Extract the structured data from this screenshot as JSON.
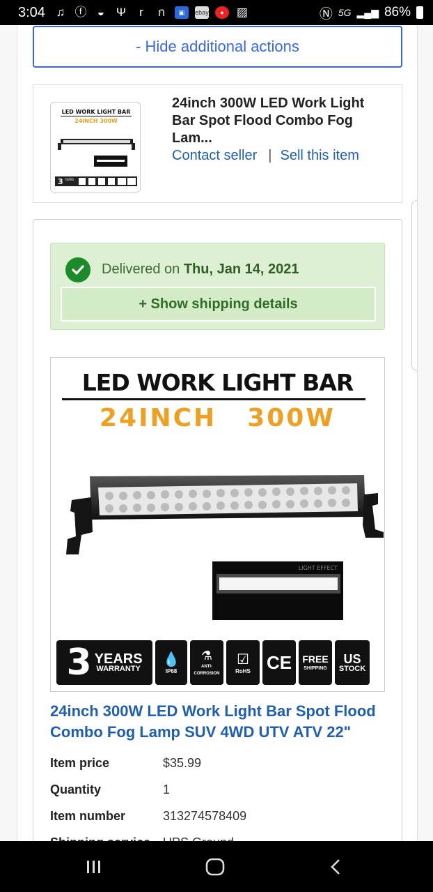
{
  "status_bar": {
    "time": "3:04",
    "signal": "5G",
    "battery": "86%"
  },
  "actions": {
    "hide_label": "- Hide additional actions"
  },
  "item_summary": {
    "title": "24inch 300W LED Work Light Bar Spot Flood Combo Fog Lam...",
    "contact_seller": "Contact seller",
    "separator": "|",
    "sell_item": "Sell this item"
  },
  "delivery": {
    "prefix": "Delivered on ",
    "date": "Thu, Jan 14, 2021",
    "show_shipping": "+ Show shipping details"
  },
  "product_image": {
    "heading": "LED WORK LIGHT BAR",
    "size": "24INCH",
    "power": "300W",
    "light_effect": "LIGHT EFFECT",
    "badges": {
      "warranty_num": "3",
      "warranty_years": "YEARS",
      "warranty_word": "WARRANTY",
      "ip": "IP68",
      "corrosion": "ANTI-CORROSION",
      "rohs": "RoHS",
      "ce": "CE",
      "free": "FREE",
      "shipping": "SHIPPING",
      "us": "US",
      "stock": "STOCK"
    }
  },
  "product": {
    "title": "24inch 300W LED Work Light Bar Spot Flood Combo Fog Lamp SUV 4WD UTV ATV 22\"",
    "details": [
      {
        "label": "Item price",
        "value": "$35.99"
      },
      {
        "label": "Quantity",
        "value": "1"
      },
      {
        "label": "Item number",
        "value": "313274578409"
      },
      {
        "label": "Shipping service",
        "value": "UPS Ground"
      }
    ]
  },
  "colors": {
    "link_blue": "#1e5eb5",
    "button_blue": "#3665f3",
    "delivered_green_bg": "#def0d4",
    "check_green": "#1b8a29",
    "badge_orange": "#f0a020"
  }
}
